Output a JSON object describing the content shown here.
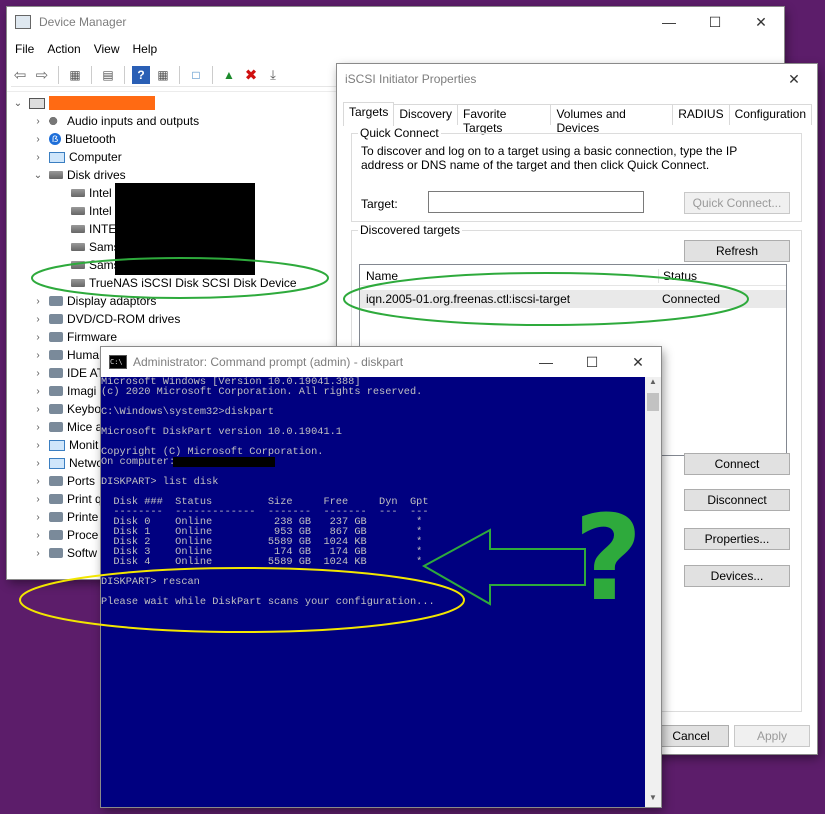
{
  "device_manager": {
    "title": "Device Manager",
    "menu": [
      "File",
      "Action",
      "View",
      "Help"
    ],
    "tree": {
      "categories": [
        {
          "label": "Audio inputs and outputs",
          "icon": "speaker-icon"
        },
        {
          "label": "Bluetooth",
          "icon": "bluetooth-icon"
        },
        {
          "label": "Computer",
          "icon": "computer-icon"
        },
        {
          "label": "Disk drives",
          "icon": "disk-icon"
        }
      ],
      "disks": [
        "Intel",
        "Intel",
        "INTEL",
        "Sams",
        "Sams",
        "TrueNAS iSCSI Disk SCSI Disk Device"
      ],
      "more": [
        "Display adaptors",
        "DVD/CD-ROM drives",
        "Firmware",
        "Huma",
        "IDE AT",
        "Imagi",
        "Keybo",
        "Mice a",
        "Monit",
        "Netwo",
        "Ports",
        "Print q",
        "Printe",
        "Proce",
        "Softw"
      ]
    }
  },
  "iscsi": {
    "title": "iSCSI Initiator Properties",
    "tabs": [
      "Targets",
      "Discovery",
      "Favorite Targets",
      "Volumes and Devices",
      "RADIUS",
      "Configuration"
    ],
    "quick_connect": {
      "label": "Quick Connect",
      "description": "To discover and log on to a target using a basic connection, type the IP address or DNS name of the target and then click Quick Connect.",
      "target_label": "Target:",
      "target_value": "",
      "button": "Quick Connect..."
    },
    "discovered": {
      "label": "Discovered targets",
      "refresh": "Refresh",
      "columns": [
        "Name",
        "Status"
      ],
      "rows": [
        {
          "name": "iqn.2005-01.org.freenas.ctl:iscsi-target",
          "status": "Connected"
        }
      ]
    },
    "buttons": {
      "connect": "Connect",
      "disconnect": "Disconnect",
      "properties": "Properties...",
      "devices": "Devices...",
      "cancel": "Cancel",
      "apply": "Apply"
    }
  },
  "cmd": {
    "title": "Administrator: Command prompt  (admin) - diskpart",
    "lines": [
      "Microsoft Windows [Version 10.0.19041.388]",
      "(c) 2020 Microsoft Corporation. All rights reserved.",
      "",
      "C:\\Windows\\system32>diskpart",
      "",
      "Microsoft DiskPart version 10.0.19041.1",
      "",
      "Copyright (C) Microsoft Corporation.",
      "On computer:",
      "",
      "DISKPART> list disk",
      "",
      "  Disk ###  Status         Size     Free     Dyn  Gpt",
      "  --------  -------------  -------  -------  ---  ---",
      "  Disk 0    Online          238 GB   237 GB        *",
      "  Disk 1    Online          953 GB   867 GB        *",
      "  Disk 2    Online         5589 GB  1024 KB        *",
      "  Disk 3    Online          174 GB   174 GB        *",
      "  Disk 4    Online         5589 GB  1024 KB        *",
      "",
      "DISKPART> rescan",
      "",
      "Please wait while DiskPart scans your configuration..."
    ]
  },
  "annotation": {
    "question_mark": "?",
    "green": "#2eaa3c",
    "yellow": "#f2e600",
    "redact_orange": "#ff6a13"
  }
}
